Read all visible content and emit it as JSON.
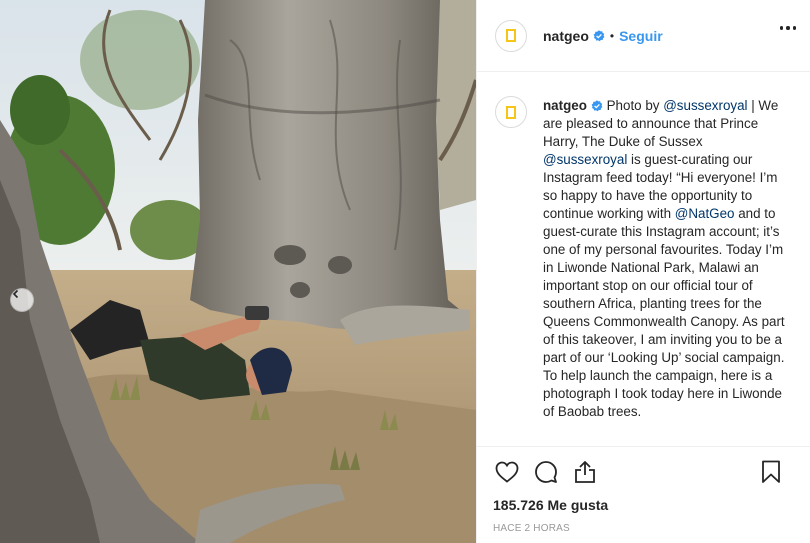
{
  "post": {
    "username": "natgeo",
    "follow_label": "Seguir",
    "separator": "•",
    "caption_user": "natgeo",
    "caption_segments": [
      {
        "text": " Photo by ",
        "type": "text"
      },
      {
        "text": "@sussexroyal",
        "type": "mention"
      },
      {
        "text": " | We are pleased to announce that Prince Harry, The Duke of Sussex ",
        "type": "text"
      },
      {
        "text": "@sussexroyal",
        "type": "mention"
      },
      {
        "text": " is guest-curating our Instagram feed today! “Hi everyone! I’m so happy to have the opportunity to continue working with ",
        "type": "text"
      },
      {
        "text": "@NatGeo",
        "type": "mention"
      },
      {
        "text": " and to guest-curate this Instagram account; it’s one of my personal favourites. Today I’m in Liwonde National Park, Malawi an important stop on our official tour of southern Africa, planting trees for the Queens Commonwealth Canopy. As part of this takeover, I am inviting you to be a part of our ‘Looking Up’ social campaign. To help launch the campaign, here is a photograph I took today here in Liwonde of Baobab trees.",
        "type": "text"
      }
    ],
    "likes": "185.726 Me gusta",
    "timestamp": "Hace 2 horas"
  },
  "icons": {
    "verified": "verified-badge-icon",
    "more": "more-options-icon",
    "like": "heart-icon",
    "comment": "comment-icon",
    "share": "share-icon",
    "save": "bookmark-icon",
    "prev": "chevron-left-icon"
  },
  "colors": {
    "link": "#3897f0",
    "mention": "#003569",
    "brand_yellow": "#f5c518",
    "border": "#efefef"
  }
}
